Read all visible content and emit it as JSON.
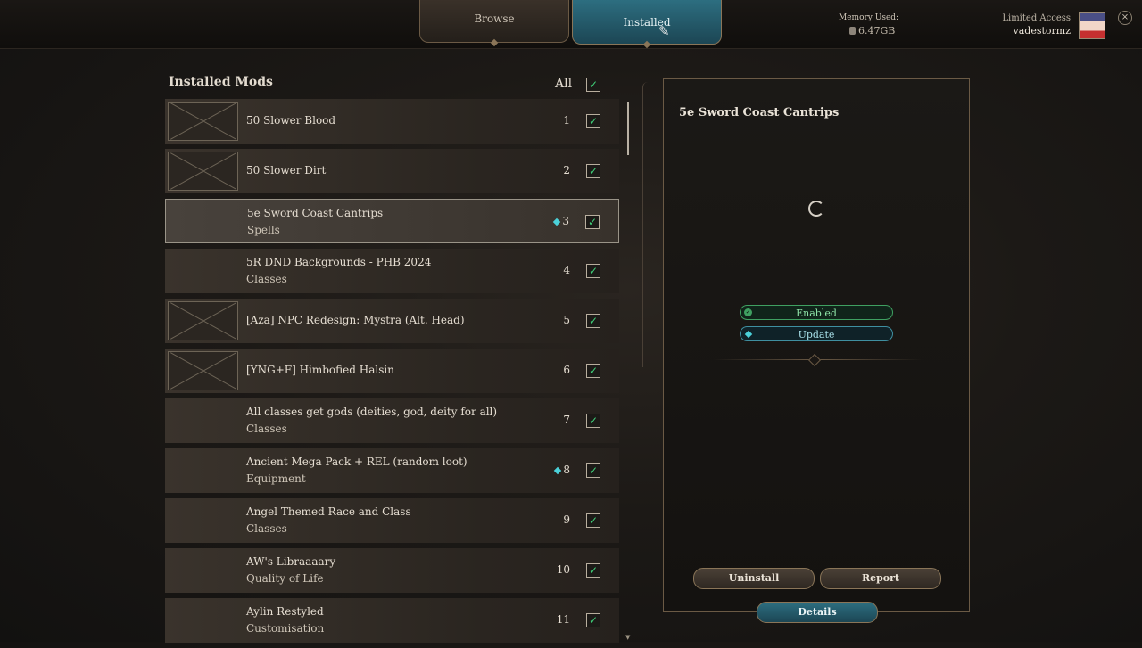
{
  "header": {
    "tabs": [
      {
        "label": "Browse",
        "active": false
      },
      {
        "label": "Installed",
        "active": true
      }
    ],
    "memory_label": "Memory Used:",
    "memory_value": "6.47GB",
    "access_label": "Limited Access",
    "username": "vadestormz",
    "close_glyph": "×"
  },
  "list": {
    "title": "Installed Mods",
    "all_label": "All",
    "all_checked": true,
    "items": [
      {
        "name": "50 Slower Blood",
        "category": "",
        "order": "1",
        "thumb": true,
        "update": false
      },
      {
        "name": "50 Slower Dirt",
        "category": "",
        "order": "2",
        "thumb": true,
        "update": false
      },
      {
        "name": "5e Sword Coast Cantrips",
        "category": "Spells",
        "order": "3",
        "thumb": false,
        "update": true
      },
      {
        "name": "5R DND Backgrounds - PHB 2024",
        "category": "Classes",
        "order": "4",
        "thumb": false,
        "update": false
      },
      {
        "name": "[Aza] NPC Redesign: Mystra (Alt. Head)",
        "category": "",
        "order": "5",
        "thumb": true,
        "update": false
      },
      {
        "name": "[YNG+F] Himbofied Halsin",
        "category": "",
        "order": "6",
        "thumb": true,
        "update": false
      },
      {
        "name": "All classes get gods (deities, god, deity for all)",
        "category": "Classes",
        "order": "7",
        "thumb": false,
        "update": false
      },
      {
        "name": "Ancient Mega Pack + REL (random loot)",
        "category": "Equipment",
        "order": "8",
        "thumb": false,
        "update": true
      },
      {
        "name": "Angel Themed Race and Class",
        "category": "Classes",
        "order": "9",
        "thumb": false,
        "update": false
      },
      {
        "name": "AW's Libraaaary",
        "category": "Quality of Life",
        "order": "10",
        "thumb": false,
        "update": false
      },
      {
        "name": "Aylin Restyled",
        "category": "Customisation",
        "order": "11",
        "thumb": false,
        "update": false
      }
    ],
    "selected_index": 2
  },
  "details": {
    "title": "5e Sword Coast Cantrips",
    "status_enabled": "Enabled",
    "status_update": "Update",
    "uninstall_label": "Uninstall",
    "report_label": "Report",
    "details_label": "Details"
  },
  "colors": {
    "accent": "#2d6e80",
    "check": "#3fd27a",
    "update_dot": "#4bd1d9"
  }
}
